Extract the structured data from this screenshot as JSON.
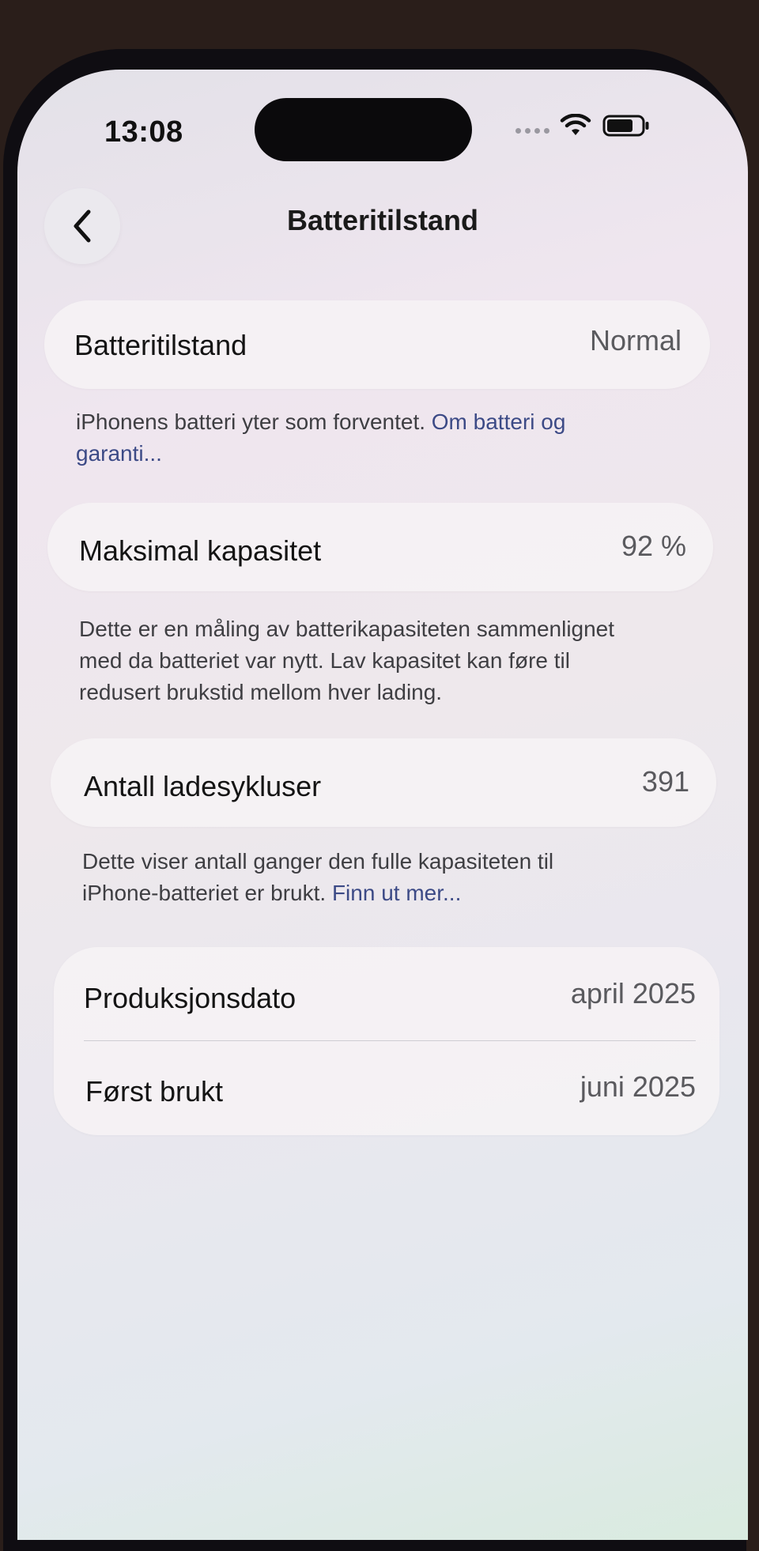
{
  "status_bar": {
    "time": "13:08"
  },
  "nav": {
    "title": "Batteritilstand"
  },
  "battery_health": {
    "label": "Batteritilstand",
    "value": "Normal",
    "footnote": "iPhonens batteri yter som forventet.",
    "link": "Om batteri og garanti..."
  },
  "max_capacity": {
    "label": "Maksimal kapasitet",
    "value": "92 %",
    "footnote_line1": "Dette er en måling av batterikapasiteten sammenlignet",
    "footnote_line2": "med da batteriet var nytt. Lav kapasitet kan føre til",
    "footnote_line3": "redusert brukstid mellom hver lading."
  },
  "charge_cycles": {
    "label": "Antall ladesykluser",
    "value": "391",
    "footnote_line1": "Dette viser antall ganger den fulle kapasiteten til",
    "footnote_line2": "iPhone-batteriet er brukt.",
    "link": "Finn ut mer..."
  },
  "dates": {
    "manufacture_label": "Produksjonsdato",
    "manufacture_value": "april 2025",
    "first_use_label": "Først brukt",
    "first_use_value": "juni 2025"
  },
  "icons": {
    "back": "chevron-left-icon",
    "wifi": "wifi-icon",
    "battery": "battery-icon"
  }
}
